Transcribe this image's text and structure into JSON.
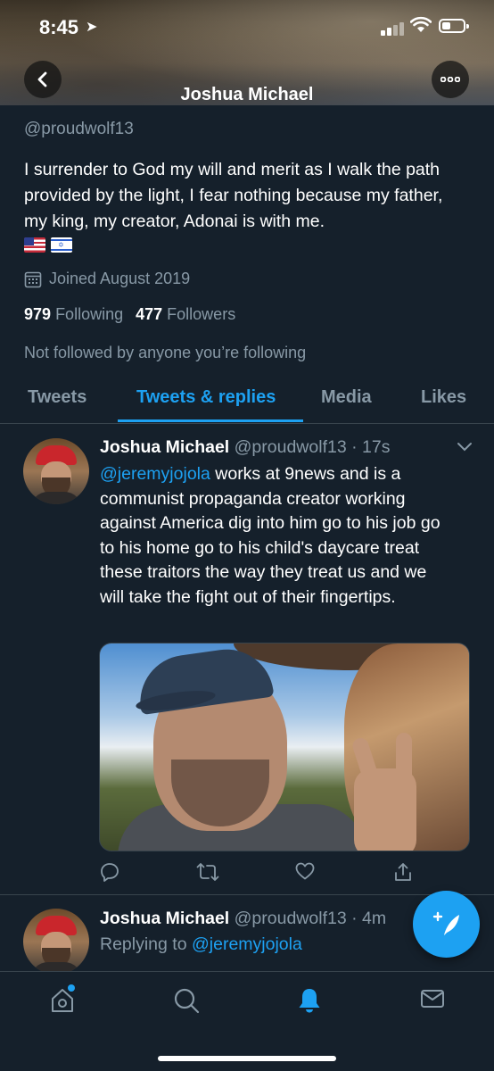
{
  "status_bar": {
    "time": "8:45",
    "location_glyph": "➤"
  },
  "header": {
    "title": "Joshua Michael"
  },
  "profile": {
    "handle": "@proudwolf13",
    "bio": "I surrender to God my will and merit as I walk the path provided by the light, I fear nothing because my father, my king, my creator, Adonai is with me.",
    "joined": "Joined August 2019",
    "following_count": "979",
    "following_label": "Following",
    "followers_count": "477",
    "followers_label": "Followers",
    "not_followed": "Not followed by anyone you’re following"
  },
  "tabs": [
    {
      "label": "Tweets"
    },
    {
      "label": "Tweets & replies"
    },
    {
      "label": "Media"
    },
    {
      "label": "Likes"
    }
  ],
  "tweets": [
    {
      "name": "Joshua Michael",
      "meta": "@proudwolf13 · 17s",
      "mention": "@jeremyjojola",
      "text": " works at 9news and is a communist propaganda creator working against America dig into him go to his job go to his home go to his child's daycare treat these traitors the way they treat us and we will take the fight out of their fingertips."
    },
    {
      "name": "Joshua Michael",
      "meta": "@proudwolf13 · 4m",
      "replying_prefix": "Replying to ",
      "replying_to": "@jeremyjojola"
    }
  ],
  "colors": {
    "background": "#15202b",
    "accent": "#1da1f2",
    "muted": "#8899a6",
    "divider": "#38444d"
  }
}
